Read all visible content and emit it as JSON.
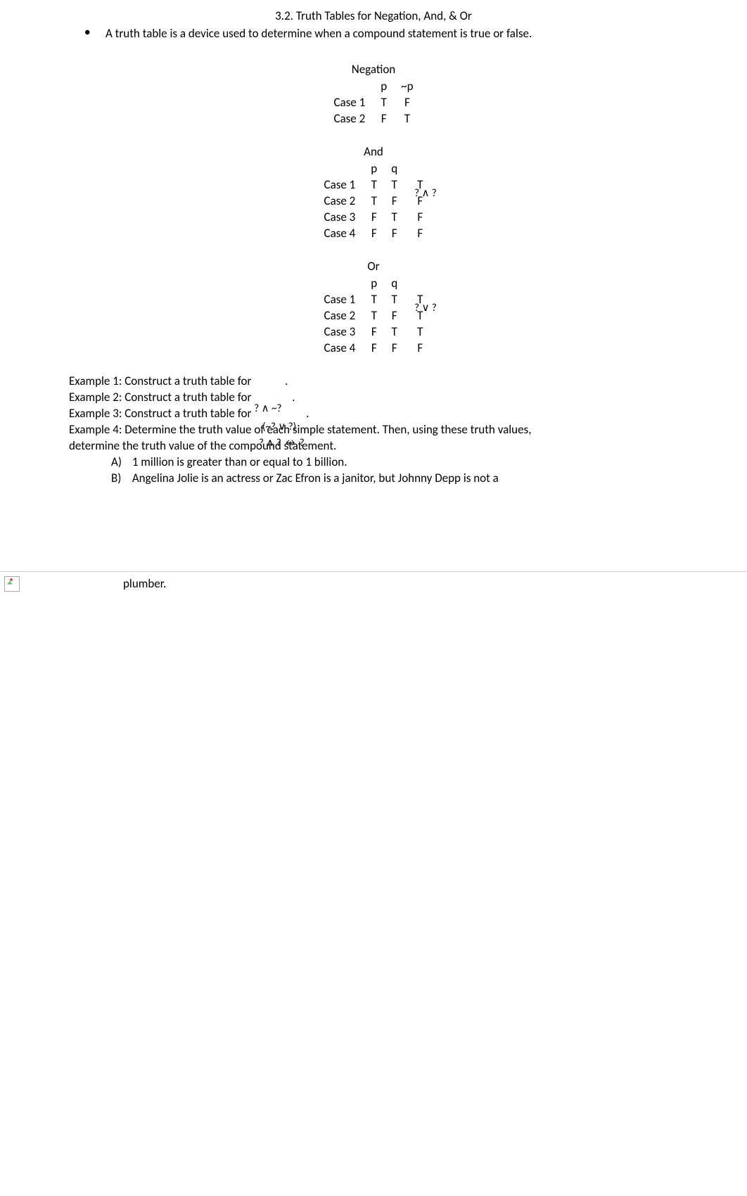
{
  "section_title": "3.2. Truth Tables for Negation, And, & Or",
  "intro_bullet": "A truth table is a device used to determine when a compound statement is true or false.",
  "tables": {
    "negation": {
      "title": "Negation",
      "headers": [
        "",
        "p",
        "~p"
      ],
      "rows": [
        [
          "Case 1",
          "T",
          "F"
        ],
        [
          "Case 2",
          "F",
          "T"
        ]
      ]
    },
    "and": {
      "title": "And",
      "headers": [
        "",
        "p",
        "q",
        ""
      ],
      "result_header": "? ∧ ?",
      "rows": [
        [
          "Case 1",
          "T",
          "T",
          "T"
        ],
        [
          "Case 2",
          "T",
          "F",
          "F"
        ],
        [
          "Case 3",
          "F",
          "T",
          "F"
        ],
        [
          "Case 4",
          "F",
          "F",
          "F"
        ]
      ]
    },
    "or": {
      "title": "Or",
      "headers": [
        "",
        "p",
        "q",
        ""
      ],
      "result_header": "? ∨ ?",
      "rows": [
        [
          "Case 1",
          "T",
          "T",
          "T"
        ],
        [
          "Case 2",
          "T",
          "F",
          "T"
        ],
        [
          "Case 3",
          "F",
          "T",
          "T"
        ],
        [
          "Case 4",
          "F",
          "F",
          "F"
        ]
      ]
    }
  },
  "examples": {
    "ex1": "Example 1:  Construct a truth table for ",
    "ex1_trail": ".",
    "ex2": "Example 2: Construct a truth table for ",
    "ex2_trail": ".",
    "ex3": "Example 3: Construct a truth table for ",
    "ex3_expr": "? ∧ ~?",
    "ex3_trail": ".",
    "ex4a": "Example 4: Determine the truth value of each simple statement. Then, using these truth values,",
    "ex4_overlay1": "(~? ∨ ?)",
    "ex4b": "determine the truth value of the compound statement.",
    "ex4_overlay2": "? ∧ ? ↔ ?",
    "optA_label": "A)",
    "optA": "1 million is greater than or equal to 1 billion.",
    "optB_label": "B)",
    "optB": "Angelina Jolie is an actress or Zac Efron is a janitor, but Johnny Depp is not a"
  },
  "page2": {
    "continuation": "plumber."
  }
}
